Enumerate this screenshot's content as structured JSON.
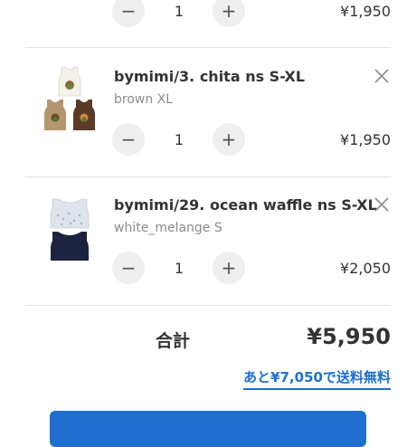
{
  "cart": {
    "items": [
      {
        "title": "",
        "variant": "",
        "quantity": "1",
        "price": "¥1,950"
      },
      {
        "title": "bymimi/3. chita ns S-XL",
        "variant": "brown XL",
        "quantity": "1",
        "price": "¥1,950"
      },
      {
        "title": "bymimi/29. ocean waffle ns S-XL",
        "variant": "white_melange S",
        "quantity": "1",
        "price": "¥2,050"
      }
    ],
    "stepper": {
      "minus": "−",
      "plus": "+"
    }
  },
  "summary": {
    "total_label": "合計",
    "total_value": "¥5,950",
    "free_shipping_link": "あと¥7,050で送料無料"
  },
  "colors": {
    "accent": "#1f6fd1",
    "text": "#333333",
    "muted": "#8c8c8c",
    "stepper_bg": "#efefef"
  },
  "icons": {
    "minus": "minus-icon",
    "plus": "plus-icon",
    "remove": "close-icon"
  }
}
